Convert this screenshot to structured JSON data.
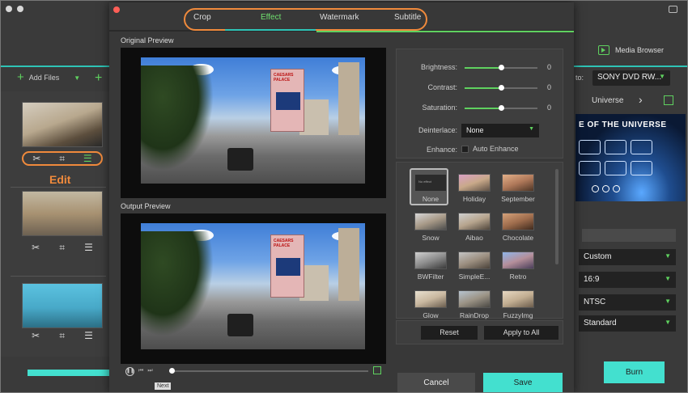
{
  "app": {
    "media_browser_label": "Media Browser",
    "add_files_label": "Add Files",
    "to_label": "to:",
    "output_format": "SONY DVD RW...",
    "edit_callout": "Edit",
    "theme_name": "Universe",
    "theme_title": "E OF THE UNIVERSE",
    "settings": [
      "Custom",
      "16:9",
      "NTSC",
      "Standard"
    ],
    "burn_label": "Burn",
    "accent_color": "#43e0cf",
    "highlight_color": "#f08a3c"
  },
  "dialog": {
    "tabs": [
      {
        "label": "Crop",
        "active": false
      },
      {
        "label": "Effect",
        "active": true
      },
      {
        "label": "Watermark",
        "active": false
      },
      {
        "label": "Subtitle",
        "active": false
      }
    ],
    "original_preview_label": "Original Preview",
    "output_preview_label": "Output Preview",
    "sign_text": "CAESARS PALACE",
    "next_tooltip": "Next",
    "adjustments": {
      "brightness": {
        "label": "Brightness:",
        "value": "0",
        "position": 0.5
      },
      "contrast": {
        "label": "Contrast:",
        "value": "0",
        "position": 0.5
      },
      "saturation": {
        "label": "Saturation:",
        "value": "0",
        "position": 0.5
      },
      "deinterlace": {
        "label": "Deinterlace:",
        "value": "None"
      },
      "enhance": {
        "label": "Enhance:",
        "checkbox_label": "Auto Enhance",
        "checked": false
      }
    },
    "effects": [
      {
        "label": "None",
        "thumb_text": "No effect",
        "selected": true
      },
      {
        "label": "Holiday"
      },
      {
        "label": "September"
      },
      {
        "label": "Snow"
      },
      {
        "label": "Aibao"
      },
      {
        "label": "Chocolate"
      },
      {
        "label": "BWFilter"
      },
      {
        "label": "SimpleE..."
      },
      {
        "label": "Retro"
      },
      {
        "label": "Glow"
      },
      {
        "label": "RainDrop"
      },
      {
        "label": "FuzzyImg"
      }
    ],
    "reset_label": "Reset",
    "apply_all_label": "Apply to All",
    "cancel_label": "Cancel",
    "save_label": "Save"
  }
}
